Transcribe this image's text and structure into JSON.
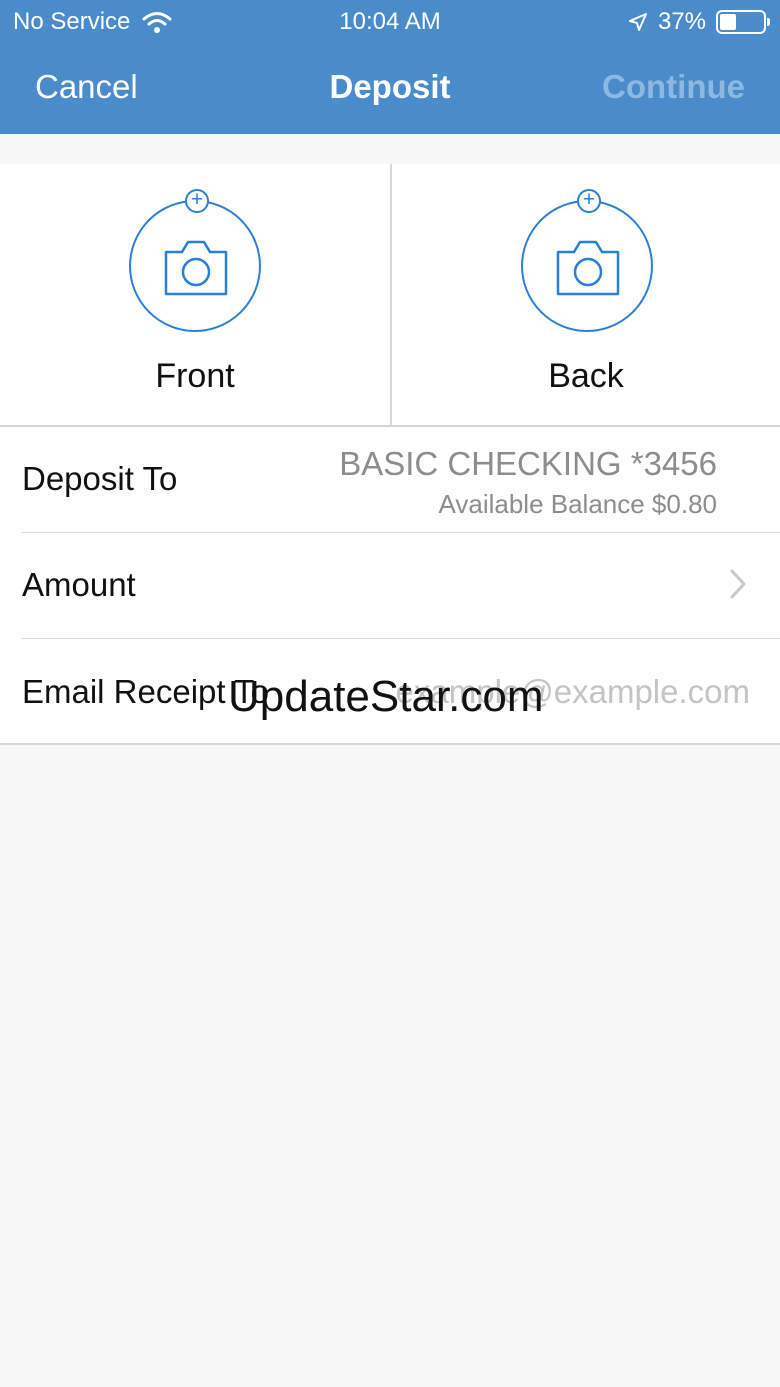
{
  "status_bar": {
    "carrier": "No Service",
    "time": "10:04 AM",
    "battery_percent_text": "37%",
    "battery_level": 0.37,
    "icons": [
      "wifi-icon",
      "location-arrow-icon",
      "battery-icon"
    ]
  },
  "nav": {
    "cancel_label": "Cancel",
    "title": "Deposit",
    "continue_label": "Continue"
  },
  "capture": {
    "front_label": "Front",
    "back_label": "Back",
    "icon": "camera-icon",
    "badge_icon": "plus-icon"
  },
  "form": {
    "deposit_to_label": "Deposit To",
    "account_name": "BASIC CHECKING *3456",
    "account_balance": "Available Balance $0.80",
    "amount_label": "Amount",
    "email_label": "Email Receipt To",
    "email_placeholder": "example@example.com",
    "email_value": ""
  },
  "watermark": "UpdateStar.com",
  "colors": {
    "nav_bg": "#4a8ccb",
    "accent": "#2a7fd8",
    "disabled_text": "#8db8e2",
    "secondary_text": "#8d8d8d",
    "page_bg": "#f7f7f7"
  }
}
